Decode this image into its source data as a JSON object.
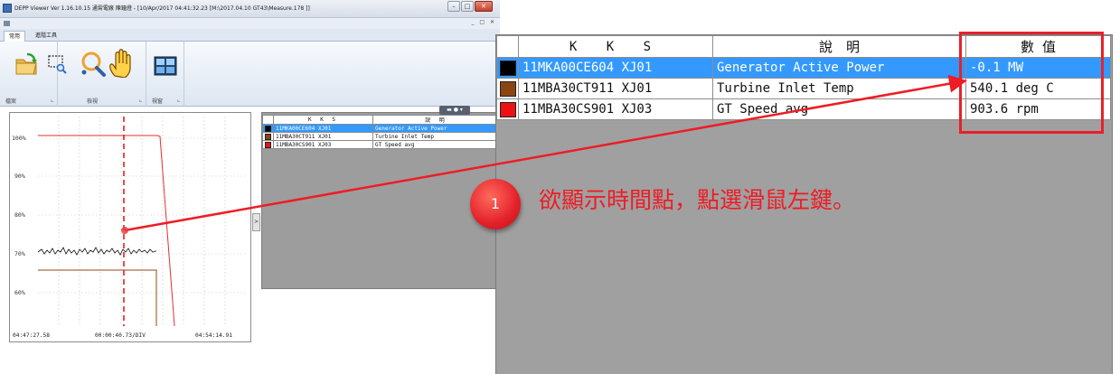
{
  "window": {
    "title": "DEPP Viewer Ver 1.16.10.15 通霄電廠 陳鐘燈 - [10/Apr/2017 04:41:32.23   [M:\\2017.04.10 GT43\\Measure.178 ]]",
    "min": "–",
    "max": "□",
    "close": "✕",
    "mdi_buttons": "_ □ ✕"
  },
  "ribbon": {
    "tabs": [
      "常用",
      "進階工具"
    ],
    "groups": [
      "檔案",
      "檢視",
      "視窗"
    ],
    "icons": [
      "open-folder-icon",
      "zoom-rectangle-icon",
      "magnifier-icon",
      "pan-hand-icon",
      "window-layout-icon"
    ]
  },
  "chart": {
    "y_ticks": [
      "100%",
      "90%",
      "80%",
      "70%",
      "60%"
    ],
    "x_start": "04:47:27.58",
    "x_div": "00:00:40.73/DIV",
    "x_end": "04:54:14.91",
    "colors": {
      "series1": "#1a1a1a",
      "series2": "#8b4a17",
      "series3": "#e02020",
      "cursor": "#e02020"
    }
  },
  "mini_table": {
    "headers": [
      "K K S",
      "說 明"
    ],
    "rows": [
      {
        "kks": "11MKA00CE604 XJ01",
        "desc": "Generator Active Power",
        "color": "#000000"
      },
      {
        "kks": "11MBA30CT911 XJ01",
        "desc": "Turbine Inlet Temp",
        "color": "#8b4513"
      },
      {
        "kks": "11MBA30CS901 XJ03",
        "desc": "GT Speed avg",
        "color": "#ee1111"
      }
    ]
  },
  "big_table": {
    "headers": [
      "K K S",
      "說　明",
      "數 值"
    ],
    "rows": [
      {
        "kks": "11MKA00CE604 XJ01",
        "desc": "Generator Active Power",
        "value": "-0.1 MW",
        "color": "#000000"
      },
      {
        "kks": "11MBA30CT911 XJ01",
        "desc": "Turbine Inlet Temp",
        "value": "540.1 deg C",
        "color": "#8b4513"
      },
      {
        "kks": "11MBA30CS901 XJ03",
        "desc": "GT Speed avg",
        "value": "903.6 rpm",
        "color": "#ee1111"
      }
    ]
  },
  "annotation": {
    "number": "1",
    "text": "欲顯示時間點，點選滑鼠左鍵。",
    "color": "#ee1c25"
  }
}
